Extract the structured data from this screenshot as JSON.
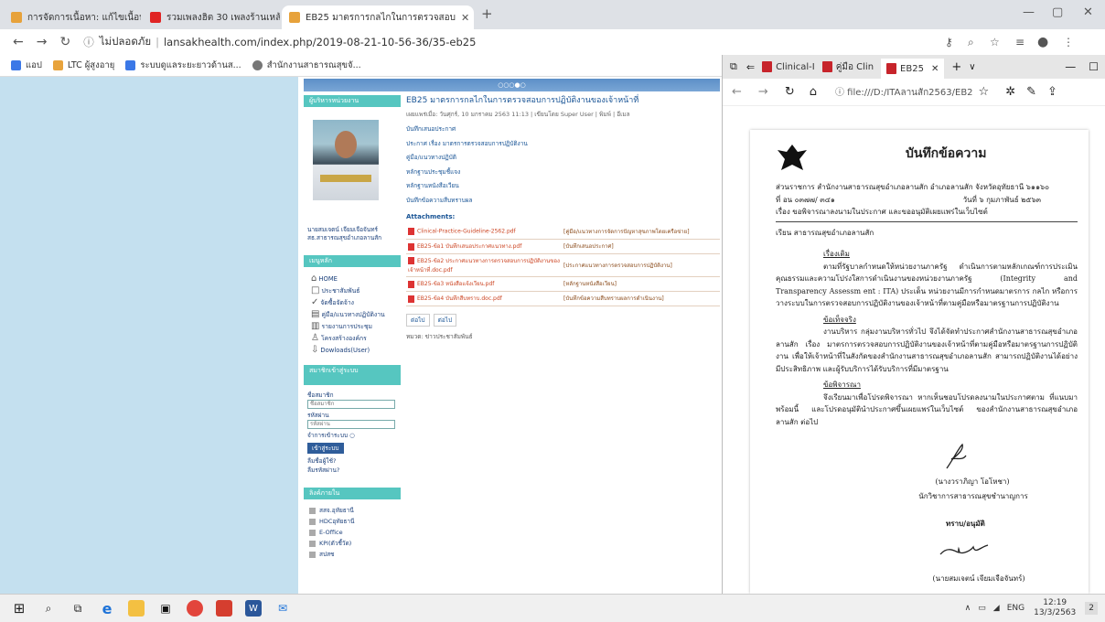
{
  "chrome": {
    "tabs": [
      {
        "label": "การจัดการเนื้อหา: แก้ไขเนื้อหา - lansa",
        "color": "#e7a23b"
      },
      {
        "label": "รวมเพลงฮิต 30 เพลงร้านเหล้า ฟั",
        "color": "#e02424"
      },
      {
        "label": "EB25 มาตรการกลไกในการตรวจสอบ",
        "color": "#e7a23b"
      }
    ],
    "new_tab": "+",
    "url_prefix": "ไม่ปลอดภัย",
    "url": "lansakhealth.com/index.php/2019-08-21-10-56-36/35-eb25",
    "bookmarks": [
      {
        "label": "แอป",
        "color": "#3b78e7"
      },
      {
        "label": "LTC ผู้สูงอายุ",
        "color": "#e8a33c"
      },
      {
        "label": "ระบบดูแลระยะยาวด้านส...",
        "color": "#3b78e7"
      },
      {
        "label": "สำนักงานสาธารณสุขจั...",
        "color": "#777777"
      }
    ]
  },
  "site": {
    "top_strip": "○○○●○",
    "profile_head": "ผู้บริหารหน่วยงาน",
    "profile_name": "นายสมเจตน์ เจียมเจือจันทร์",
    "profile_role": "สธ.สาธารณสุขอำเภอลานสัก",
    "menu_head": "เมนูหลัก",
    "menu": [
      {
        "label": "HOME",
        "icon": "home-icon",
        "glyph": "⌂"
      },
      {
        "label": "ประชาสัมพันธ์",
        "icon": "document-icon",
        "glyph": "□"
      },
      {
        "label": "จัดซื้อจัดจ้าง",
        "icon": "check-icon",
        "glyph": "✓"
      },
      {
        "label": "คู่มือ/แนวทางปฏิบัติงาน",
        "icon": "book-icon",
        "glyph": "▤"
      },
      {
        "label": "รายงานการประชุม",
        "icon": "report-icon",
        "glyph": "▥"
      },
      {
        "label": "โครงสร้างองค์กร",
        "icon": "people-icon",
        "glyph": "♙"
      },
      {
        "label": "Dowloads(User)",
        "icon": "download-icon",
        "glyph": "⇩"
      }
    ],
    "login_head": "สมาชิกเข้าสู่ระบบ",
    "login_user_label": "ชื่อสมาชิก",
    "login_user_placeholder": "ชื่อสมาชิก",
    "login_pass_label": "รหัสผ่าน",
    "login_pass_placeholder": "รหัสผ่าน",
    "remember": "จำการเข้าระบบ",
    "login_button": "เข้าสู่ระบบ",
    "forgot_user": "ลืมชื่อผู้ใช้?",
    "forgot_pass": "ลืมรหัสผ่าน?",
    "links_head": "ลิงค์ภายใน",
    "links": [
      "สสจ.อุทัยธานี",
      "HDCอุทัยธานี",
      "E-Office",
      "KPI(ตัวชี้วัด)",
      "สปสช"
    ],
    "article": {
      "title": "EB25 มาตรการกลไกในการตรวจสอบการปฏิบัติงานของเจ้าหน้าที่",
      "meta": "เผยแพร่เมื่อ: วันศุกร์, 10 มกราคม 2563 11:13 | เขียนโดย Super User | พิมพ์ | อีเมล",
      "links": [
        "บันทึกเสนอประกาศ",
        "ประกาศ เรื่อง มาตรการตรวจสอบการปฏิบัติงาน",
        "คู่มือ/แนวทางปฏิบัติ",
        "หลักฐานประชุมชี้แจง",
        "หลักฐานหนังสือเวียน",
        "บันทึกข้อความสืบทราบผล"
      ],
      "attachments_label": "Attachments:",
      "attachments": [
        {
          "file": "Clinical-Practice-Guideline-2562.pdf",
          "desc": "[คู่มือ/แนวทางการจัดการปัญหาสุขภาพโดยเครือข่าย]"
        },
        {
          "file": "EB25-ข้อ1 บันทึกเสนอประกาศแนวทาง.pdf",
          "desc": "[บันทึกเสนอประกาศ]"
        },
        {
          "file": "EB25-ข้อ2 ประกาศแนวทางการตรวจสอบการปฏิบัติงานของเจ้าหน้าที่.doc.pdf",
          "desc": "[ประกาศแนวทางการตรวจสอบการปฏิบัติงาน]"
        },
        {
          "file": "EB25-ข้อ3 หนังสือแจ้งเวียน.pdf",
          "desc": "[หลักฐานหนังสือเวียน]"
        },
        {
          "file": "EB25-ข้อ4 บันทึกสืบทราบ.doc.pdf",
          "desc": "[บันทึกข้อความสืบทราบผลการดำเนินงาน]"
        }
      ],
      "prev": "ต่อไป",
      "next": "ต่อไป",
      "category": "หมวด: ข่าวประชาสัมพันธ์"
    }
  },
  "edge": {
    "tabs": [
      "Clinical-I",
      "คู่มือ Clin",
      "EB25"
    ],
    "url": "file:///D:/ITAลานสัก2563/EB2",
    "doc": {
      "heading": "บันทึกข้อความ",
      "office": "ส่วนราชการ   สำนักงานสาธารณสุขอำเภอลานสัก  อำเภอลานสัก  จังหวัดอุทัยธานี  ๖๑๑๖๐",
      "ref": "ที่  อน ๐๓๗๗/  ๓๔๑",
      "date": "วันที่  ๖  กุมภาพันธ์ ๒๕๖๓",
      "subject": "เรื่อง  ขอพิจารณาลงนามในประกาศ และขออนุมัติเผยแพร่ในเว็บไซต์",
      "to": "เรียน  สาธารณสุขอำเภอลานสัก",
      "h1": "เรื่องเดิม",
      "p1": "ตามที่รัฐบาลกำหนดให้หน่วยงานภาครัฐ ดำเนินการตามหลักเกณฑ์การประเมินคุณธรรมและความโปร่งใสการดำเนินงานของหน่วยงานภาครัฐ (Integrity and Transparency Assessm ent : ITA) ประเด็น หน่วยงานมีการกำหนดมาตรการ กลไก หรือการวางระบบในการตรวจสอบการปฏิบัติงานของเจ้าหน้าที่ตามคู่มือหรือมาตรฐานการปฏิบัติงาน",
      "h2": "ข้อเท็จจริง",
      "p2": "งานบริหาร กลุ่มงานบริหารทั่วไป จึงได้จัดทำประกาศสำนักงานสาธารณสุขอำเภอลานสัก เรื่อง มาตรการตรวจสอบการปฏิบัติงานของเจ้าหน้าที่ตามคู่มือหรือมาตรฐานการปฏิบัติงาน เพื่อให้เจ้าหน้าที่ในสังกัดของสำนักงานสาธารณสุขอำเภอลานสัก สามารถปฏิบัติงานได้อย่างมีประสิทธิภาพ และผู้รับบริการได้รับบริการที่มีมาตรฐาน",
      "h3": "ข้อพิจารณา",
      "p3": "จึงเรียนมาเพื่อโปรดพิจารณา หากเห็นชอบโปรดลงนามในประกาศตาม ที่แนบมาพร้อมนี้ และโปรดอนุมัตินำประกาศขึ้นเผยแพร่ในเว็บไซต์ ของสำนักงานสาธารณสุขอำเภอลานสัก ต่อไป",
      "signer1": "(นางวราภิญา โอโหชา)",
      "signer1_pos": "นักวิชาการสาธารณสุขชำนาญการ",
      "approve": "ทราบ/อนุมัติ",
      "signer2": "(นายสมเจตน์ เจียมเจือจันทร์)"
    }
  },
  "taskbar": {
    "lang": "ENG",
    "time": "12:19",
    "date": "13/3/2563",
    "notif": "2"
  }
}
